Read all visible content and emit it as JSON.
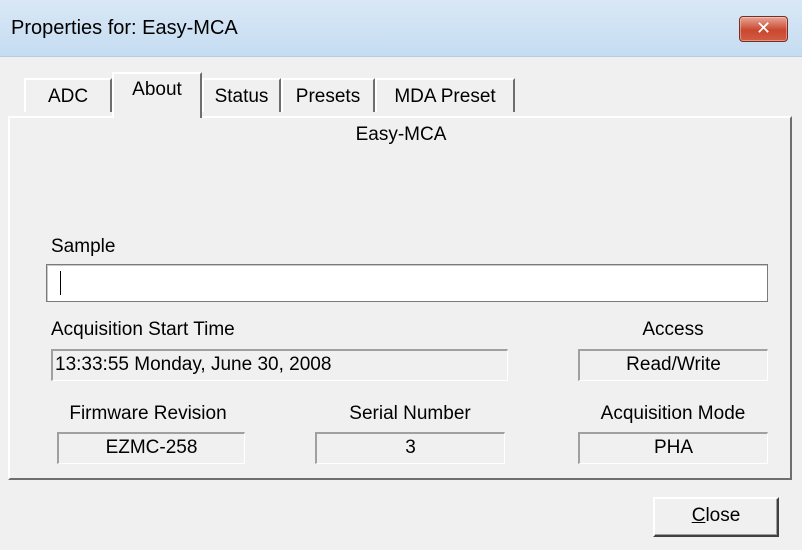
{
  "window": {
    "title": "Properties for: Easy-MCA",
    "close_glyph": "✕"
  },
  "tabs": [
    {
      "label": "ADC"
    },
    {
      "label": "About"
    },
    {
      "label": "Status"
    },
    {
      "label": "Presets"
    },
    {
      "label": "MDA Preset"
    }
  ],
  "active_tab": "About",
  "about": {
    "device_name": "Easy-MCA",
    "sample_label": "Sample",
    "sample_value": "",
    "acq_start_label": "Acquisition Start Time",
    "acq_start_value": "13:33:55 Monday, June 30, 2008",
    "access_label": "Access",
    "access_value": "Read/Write",
    "firmware_label": "Firmware Revision",
    "firmware_value": "EZMC-258",
    "serial_label": "Serial Number",
    "serial_value": "3",
    "acq_mode_label": "Acquisition Mode",
    "acq_mode_value": "PHA"
  },
  "footer": {
    "close_first": "C",
    "close_rest": "lose"
  },
  "colors": {
    "titlebar": "#c5dcf1",
    "close_button": "#c9482f",
    "face": "#f0f0f0"
  }
}
